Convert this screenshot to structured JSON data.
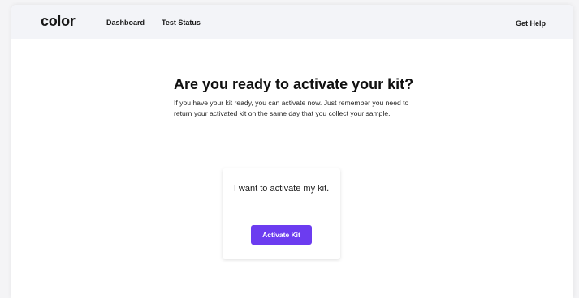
{
  "header": {
    "logo_text": "color",
    "nav": {
      "dashboard": "Dashboard",
      "test_status": "Test Status"
    },
    "help": "Get Help"
  },
  "main": {
    "title": "Are you ready to activate your kit?",
    "description": "If you have your kit ready, you can activate now. Just remember you need to return your activated kit on the same day that you collect your sample.",
    "card": {
      "text": "I want to activate my kit.",
      "button_label": "Activate Kit"
    }
  },
  "colors": {
    "accent": "#6c3cf0",
    "header_bg": "#f3f4f8"
  }
}
